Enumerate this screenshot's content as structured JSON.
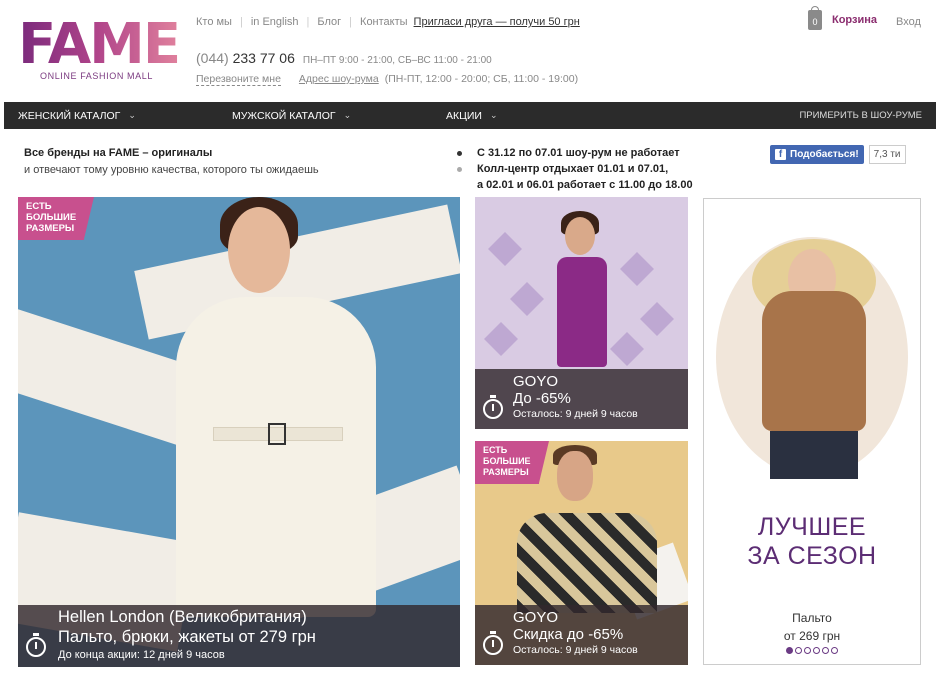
{
  "logo": {
    "word": "FAME",
    "subtitle": "ONLINE FASHION MALL"
  },
  "topnav": {
    "links": [
      "Кто мы",
      "in English",
      "Блог",
      "Контакты"
    ],
    "invite": "Пригласи друга — получи 50 грн"
  },
  "contact": {
    "phone_code": "(044)",
    "phone_number": "233 77 06",
    "hours": "ПН–ПТ 9:00 - 21:00, СБ–ВС 11:00 - 21:00",
    "callback": "Перезвоните мне",
    "showroom_link": "Адрес шоу-рума",
    "showroom_hours": "(ПН-ПТ, 12:00 - 20:00; СБ, 11:00 - 19:00)"
  },
  "cart": {
    "count": "0",
    "label": "Корзина",
    "icon": "shopping-bag-icon"
  },
  "login": "Вход",
  "menu": {
    "items": [
      "ЖЕНСКИЙ КАТАЛОГ",
      "МУЖСКОЙ КАТАЛОГ",
      "АКЦИИ"
    ],
    "right": "ПРИМЕРИТЬ В ШОУ-РУМЕ",
    "chevron": "⌄"
  },
  "brands": {
    "line1": "Все бренды на FAME – оригиналы",
    "line2": "и отвечают тому уровню качества, которого ты ожидаешь"
  },
  "notice": {
    "line1": "С 31.12 по 07.01 шоу-рум не работает",
    "line2": "Колл-центр отдыхает 01.01 и 07.01,",
    "line3": "а 02.01 и 06.01 работает с 11.00 до 18.00"
  },
  "facebook": {
    "like_label": "Подобається!",
    "count": "7,3 ти",
    "f": "f"
  },
  "banners": {
    "main": {
      "tag": [
        "ЕСТЬ",
        "БОЛЬШИЕ",
        "РАЗМЕРЫ"
      ],
      "brand": "Hellen London (Великобритания)",
      "offer": "Пальто, брюки, жакеты от 279 грн",
      "timer": "До конца акции: 12 дней 9 часов"
    },
    "dress": {
      "brand": "GOYO",
      "offer": "До -65%",
      "timer": "Осталось: 9 дней 9 часов"
    },
    "man": {
      "tag": [
        "ЕСТЬ",
        "БОЛЬШИЕ",
        "РАЗМЕРЫ"
      ],
      "brand": "GOYO",
      "offer": "Скидка до -65%",
      "timer": "Осталось: 9 дней 9 часов"
    },
    "side": {
      "title1": "ЛУЧШЕЕ",
      "title2": "ЗА СЕЗОН",
      "item": "Пальто",
      "price": "от 269 грн",
      "dots_total": 6,
      "dots_active": 1
    }
  },
  "colors": {
    "accent": "#8a2c6e",
    "tag": "#c8508e",
    "menu_bg": "#2b2b2b",
    "promo_title": "#5c2d74",
    "facebook": "#4267b2"
  }
}
